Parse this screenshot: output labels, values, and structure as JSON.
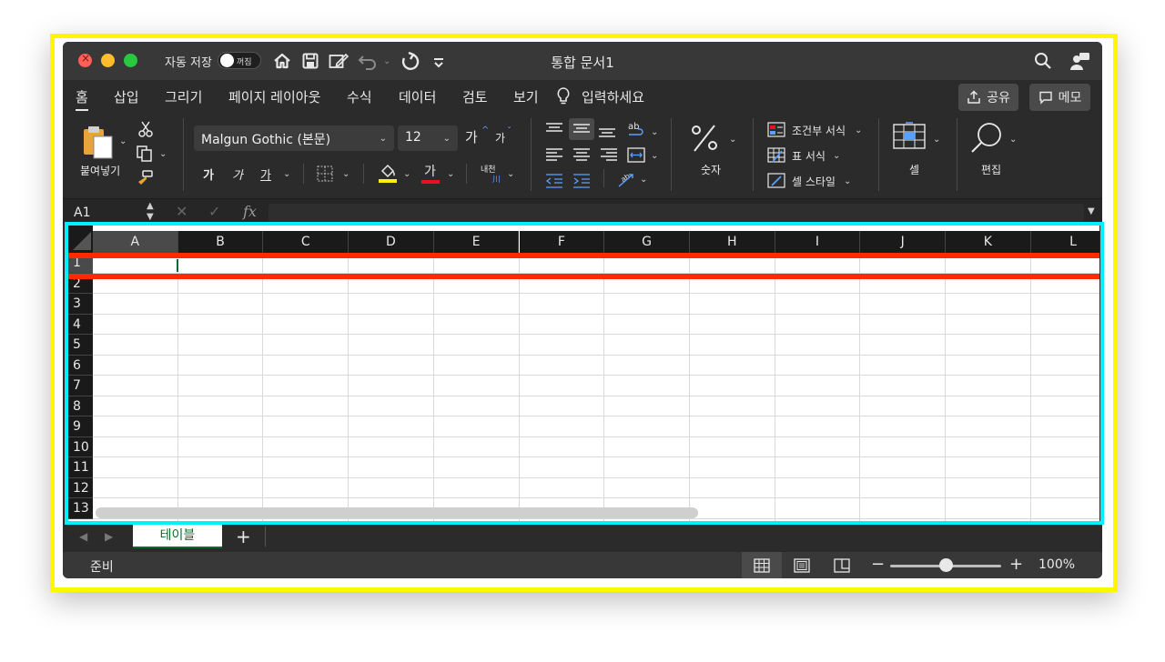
{
  "titlebar": {
    "autosave_label": "자동 저장",
    "autosave_state": "꺼짐",
    "document_title": "통합 문서1"
  },
  "tabs": [
    "홈",
    "삽입",
    "그리기",
    "페이지 레이아웃",
    "수식",
    "데이터",
    "검토",
    "보기",
    "입력하세요"
  ],
  "actions": {
    "share": "공유",
    "comments": "메모"
  },
  "ribbon": {
    "paste_label": "붙여넣기",
    "font_name": "Malgun Gothic (본문)",
    "font_size": "12",
    "grow_font": "가",
    "shrink_font": "가",
    "bold": "가",
    "italic": "가",
    "underline": "가",
    "font_color_glyph": "가",
    "phonetic": "내천",
    "number_label": "숫자",
    "conditional_format": "조건부 서식",
    "format_as_table": "표 서식",
    "cell_styles": "셀 스타일",
    "cells_label": "셀",
    "editing_label": "편집",
    "accent_yellow": "#fff200",
    "accent_red": "#e81123"
  },
  "formula": {
    "namebox": "A1",
    "fx": "fx"
  },
  "grid": {
    "columns": [
      "A",
      "B",
      "C",
      "D",
      "E",
      "F",
      "G",
      "H",
      "I",
      "J",
      "K",
      "L"
    ],
    "rows": [
      "1",
      "2",
      "3",
      "4",
      "5",
      "6",
      "7",
      "8",
      "9",
      "10",
      "11",
      "12",
      "13"
    ],
    "selected_column": "A",
    "selected_row": "1"
  },
  "sheets": {
    "tab": "테이블",
    "add": "+"
  },
  "status": {
    "ready": "준비",
    "zoom_level": "100%",
    "zoom_fraction": 0.5
  }
}
